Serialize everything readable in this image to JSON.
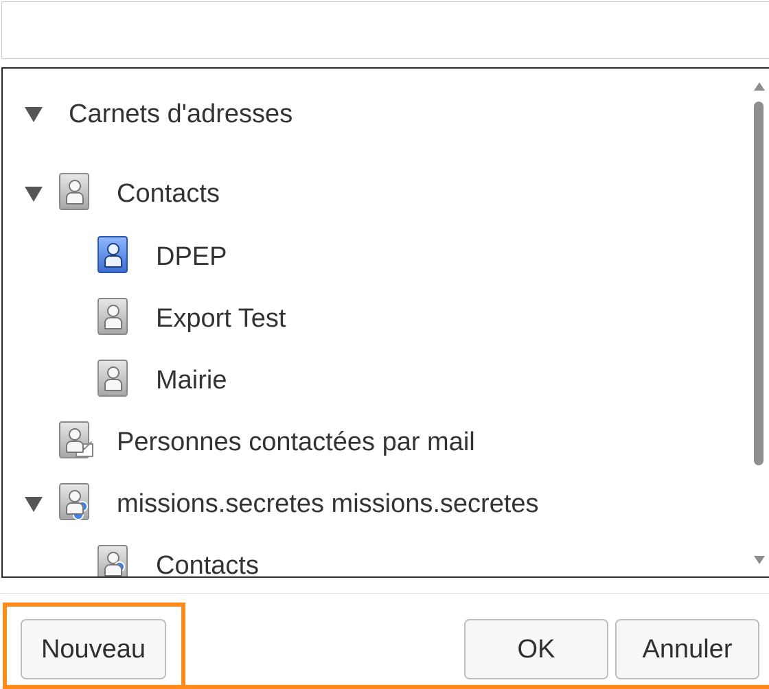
{
  "tree": {
    "root": {
      "label": "Carnets d'adresses",
      "expanded": true
    },
    "items": [
      {
        "label": "Contacts",
        "icon": "address-book-icon",
        "expanded": true
      },
      {
        "label": "DPEP",
        "icon": "address-book-selected-icon"
      },
      {
        "label": "Export Test",
        "icon": "address-book-icon"
      },
      {
        "label": "Mairie",
        "icon": "address-book-icon"
      },
      {
        "label": "Personnes contactées par mail",
        "icon": "address-book-mail-icon"
      },
      {
        "label": "missions.secretes missions.secretes",
        "icon": "shared-group-folder-icon",
        "expanded": true
      },
      {
        "label": "Contacts",
        "icon": "shared-address-book-icon"
      }
    ]
  },
  "buttons": {
    "new": "Nouveau",
    "ok": "OK",
    "cancel": "Annuler"
  },
  "colors": {
    "highlight": "#ff8c1a",
    "selected_icon": "#3b6fd1"
  }
}
